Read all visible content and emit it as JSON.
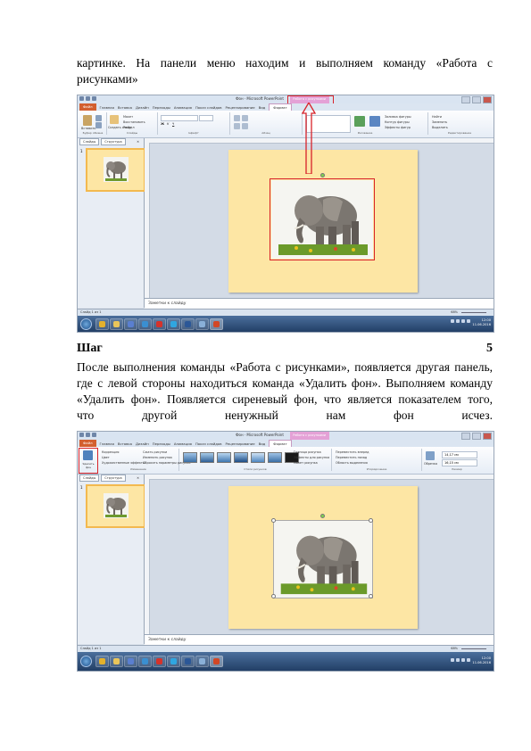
{
  "text": {
    "intro_line1": "картинке. На панели меню находим и выполняем команду «Работа с",
    "intro_line2": "рисунками»",
    "step_label": "Шаг",
    "step_number": "5",
    "body_line1": "После выполнения команды «Работа с рисунками», появляется другая панель,",
    "body_line2": "где с левой стороны находиться команда «Удалить фон». Выполняем команду",
    "body_line3": "«Удалить фон». Появляется сиреневый фон, что является показателем того,",
    "body_line4_words": [
      "что",
      "другой",
      "ненужный",
      "нам",
      "фон",
      "исчез."
    ]
  },
  "screenshot1": {
    "window_title": "Фон · Microsoft PowerPoint",
    "context_tab": "Работа с рисунками",
    "tabs": [
      "Файл",
      "Главная",
      "Вставка",
      "Дизайн",
      "Переходы",
      "Анимация",
      "Показ слайдов",
      "Рецензирование",
      "Вид",
      "Формат"
    ],
    "pane_tabs": [
      "Слайды",
      "Структура"
    ],
    "slide_number": "1",
    "notes_placeholder": "Заметки к слайду",
    "status_text": "Слайд 1 из 1",
    "zoom": "68%",
    "clock_time": "12:00",
    "clock_date": "11.06.2016",
    "group_labels": [
      "Буфер обмена",
      "Слайды",
      "Шрифт",
      "Абзац",
      "Рисование",
      "Редактирование"
    ],
    "ribbon_items": [
      "Вставить",
      "Создать слайд",
      "Макет",
      "Восстановить",
      "Раздел",
      "Экспресс-стили",
      "Заливка фигуры",
      "Контур фигуры",
      "Эффекты фигур",
      "Найти",
      "Заменить",
      "Выделить"
    ]
  },
  "screenshot2": {
    "window_title": "Фон · Microsoft PowerPoint",
    "context_tab": "Работа с рисунками",
    "tabs": [
      "Файл",
      "Главная",
      "Вставка",
      "Дизайн",
      "Переходы",
      "Анимация",
      "Показ слайдов",
      "Рецензирование",
      "Вид",
      "Формат"
    ],
    "pane_tabs": [
      "Слайды",
      "Структура"
    ],
    "slide_number": "1",
    "notes_placeholder": "Заметки к слайду",
    "status_text": "Слайд 1 из 1",
    "zoom": "68%",
    "clock_time": "12:00",
    "clock_date": "11.06.2016",
    "remove_bg_label": "Удалить фон",
    "ribbon_items": [
      "Коррекция",
      "Цвет",
      "Художественные эффекты",
      "Сжать рисунки",
      "Изменить рисунок",
      "Сбросить параметры рисунка",
      "Граница рисунка",
      "Эффекты для рисунка",
      "Макет рисунка",
      "Переместить вперед",
      "Переместить назад",
      "Область выделения",
      "Обрезка"
    ],
    "group_labels": [
      "Изменение",
      "Стили рисунков",
      "Упорядочение",
      "Размер"
    ],
    "size_height": "14,17 см",
    "size_width": "16,15 см"
  },
  "colors": {
    "slide_bg": "#fde6a4",
    "highlight_red": "#d8232a",
    "context_tab": "#e4a1d6",
    "file_tab": "#d35f2e"
  }
}
